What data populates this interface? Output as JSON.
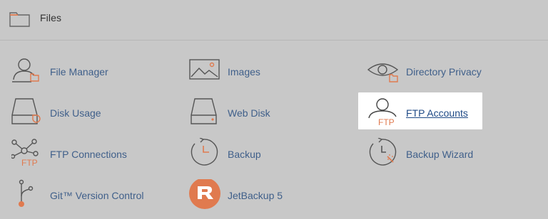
{
  "section": {
    "title": "Files",
    "icon": "folder-icon"
  },
  "items": [
    {
      "label": "File Manager",
      "icon": "user-folder-icon"
    },
    {
      "label": "Images",
      "icon": "image-icon"
    },
    {
      "label": "Directory Privacy",
      "icon": "eye-folder-icon"
    },
    {
      "label": "Disk Usage",
      "icon": "disk-usage-icon"
    },
    {
      "label": "Web Disk",
      "icon": "drive-icon"
    },
    {
      "label": "FTP Accounts",
      "icon": "ftp-user-icon",
      "badge": "FTP"
    },
    {
      "label": "FTP Connections",
      "icon": "ftp-network-icon",
      "badge": "FTP"
    },
    {
      "label": "Backup",
      "icon": "backup-clock-icon"
    },
    {
      "label": "Backup Wizard",
      "icon": "backup-wizard-icon"
    },
    {
      "label": "Git™ Version Control",
      "icon": "git-branch-icon"
    },
    {
      "label": "JetBackup 5",
      "icon": "jetbackup-logo-icon"
    }
  ],
  "colors": {
    "accent": "#e07a4f",
    "link": "#3f5f8a",
    "background": "#c8c8c8",
    "highlight": "#ffffff"
  }
}
